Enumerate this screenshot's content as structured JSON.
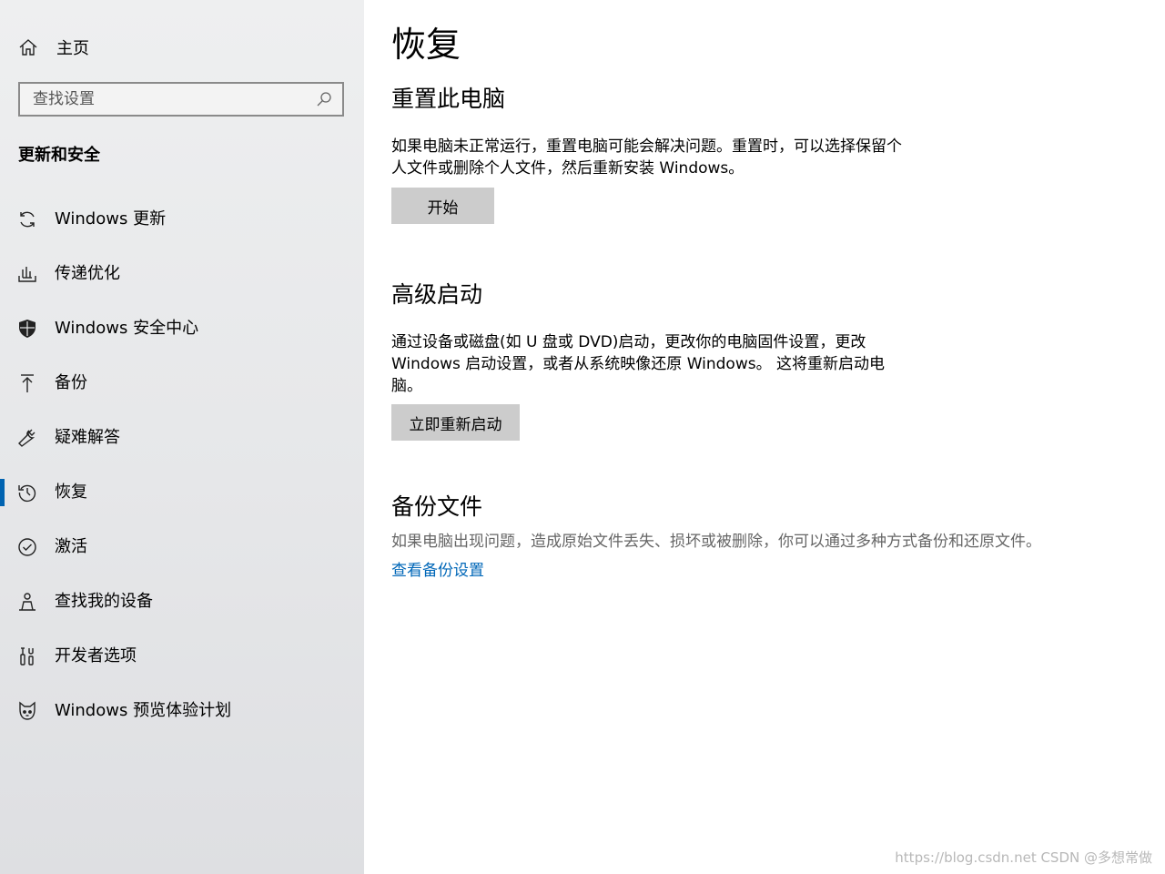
{
  "colors": {
    "accent": "#0063b1",
    "link": "#0067b8",
    "button_bg": "#cccccc",
    "sidebar_bg": "#e9eaec"
  },
  "sidebar": {
    "home": {
      "icon": "home-icon",
      "label": "主页"
    },
    "search": {
      "placeholder": "查找设置",
      "icon": "search-icon"
    },
    "section_title": "更新和安全",
    "items": [
      {
        "icon": "sync-icon",
        "label": "Windows 更新",
        "selected": false
      },
      {
        "icon": "delivery-optimization-icon",
        "label": "传递优化",
        "selected": false
      },
      {
        "icon": "shield-icon",
        "label": "Windows 安全中心",
        "selected": false
      },
      {
        "icon": "backup-upload-icon",
        "label": "备份",
        "selected": false
      },
      {
        "icon": "wrench-icon",
        "label": "疑难解答",
        "selected": false
      },
      {
        "icon": "history-icon",
        "label": "恢复",
        "selected": true
      },
      {
        "icon": "check-circle-icon",
        "label": "激活",
        "selected": false
      },
      {
        "icon": "person-location-icon",
        "label": "查找我的设备",
        "selected": false
      },
      {
        "icon": "developer-tools-icon",
        "label": "开发者选项",
        "selected": false
      },
      {
        "icon": "insider-cat-icon",
        "label": "Windows 预览体验计划",
        "selected": false
      }
    ]
  },
  "main": {
    "title": "恢复",
    "reset": {
      "heading": "重置此电脑",
      "description": "如果电脑未正常运行，重置电脑可能会解决问题。重置时，可以选择保留个人文件或删除个人文件，然后重新安装 Windows。",
      "button_label": "开始"
    },
    "advanced_startup": {
      "heading": "高级启动",
      "description": "通过设备或磁盘(如 U 盘或 DVD)启动，更改你的电脑固件设置，更改 Windows 启动设置，或者从系统映像还原 Windows。 这将重新启动电脑。",
      "button_label": "立即重新启动"
    },
    "backup_files": {
      "heading": "备份文件",
      "description": "如果电脑出现问题，造成原始文件丢失、损坏或被删除，你可以通过多种方式备份和还原文件。",
      "link_label": "查看备份设置"
    }
  },
  "watermark": "https://blog.csdn.net CSDN @多想常做"
}
